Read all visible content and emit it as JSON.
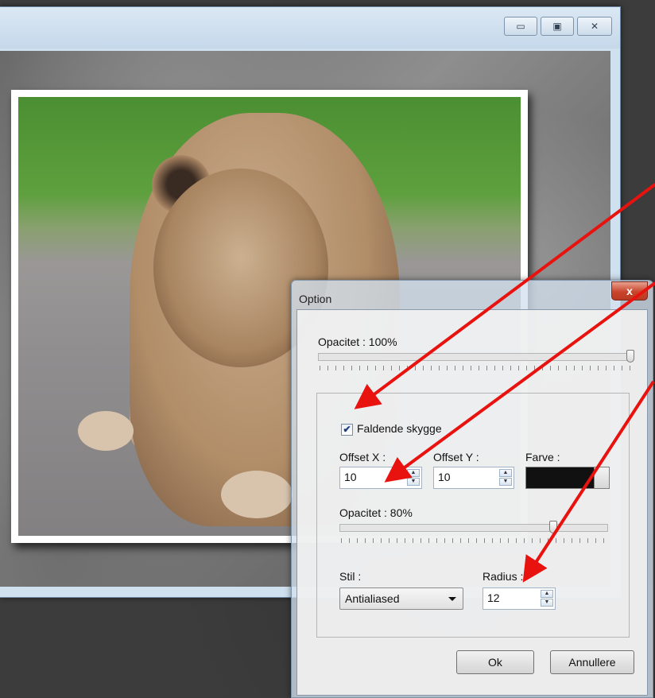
{
  "window": {
    "buttons": {
      "minimize": "▭",
      "maximize": "▣",
      "close": "✕"
    }
  },
  "dialog": {
    "title": "Option",
    "close_label": "x",
    "opacity_label": "Opacitet : 100%",
    "opacity_value": 1.0,
    "shadow_checkbox_label": "Faldende skygge",
    "shadow_checked": true,
    "check_mark": "✔",
    "offset_x_label": "Offset X :",
    "offset_x_value": "10",
    "offset_y_label": "Offset Y :",
    "offset_y_value": "10",
    "color_label": "Farve :",
    "color_value": "#111111",
    "shadow_opacity_label": "Opacitet : 80%",
    "shadow_opacity_value": 0.8,
    "style_label": "Stil :",
    "style_value": "Antialiased",
    "radius_label": "Radius :",
    "radius_value": "12",
    "ok_label": "Ok",
    "cancel_label": "Annullere",
    "spin_up": "▲",
    "spin_down": "▼"
  },
  "annotation_arrow_color": "#e8120f"
}
